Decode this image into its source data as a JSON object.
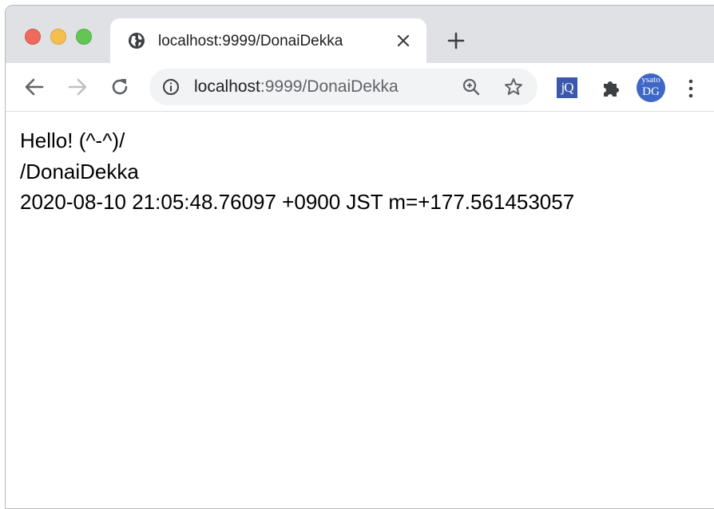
{
  "window": {
    "controls": [
      "close",
      "minimize",
      "maximize"
    ]
  },
  "tab": {
    "title": "localhost:9999/DonaiDekka",
    "favicon": "globe-icon"
  },
  "toolbar": {
    "url_host": "localhost",
    "url_rest": ":9999/DonaiDekka",
    "extensions": {
      "jquery_label": "jQ",
      "avatar_line1": "ysato",
      "avatar_line2": "DG"
    }
  },
  "page": {
    "lines": [
      "Hello! (^-^)/",
      "/DonaiDekka",
      "2020-08-10 21:05:48.76097 +0900 JST m=+177.561453057"
    ]
  },
  "colors": {
    "tabstrip": "#dfe1e5",
    "omnibox": "#f1f3f4",
    "close": "#ee6a5f",
    "minimize": "#f5be4f",
    "maximize": "#62c554",
    "avatar": "#3e67c8",
    "jquery": "#3c58ab"
  }
}
